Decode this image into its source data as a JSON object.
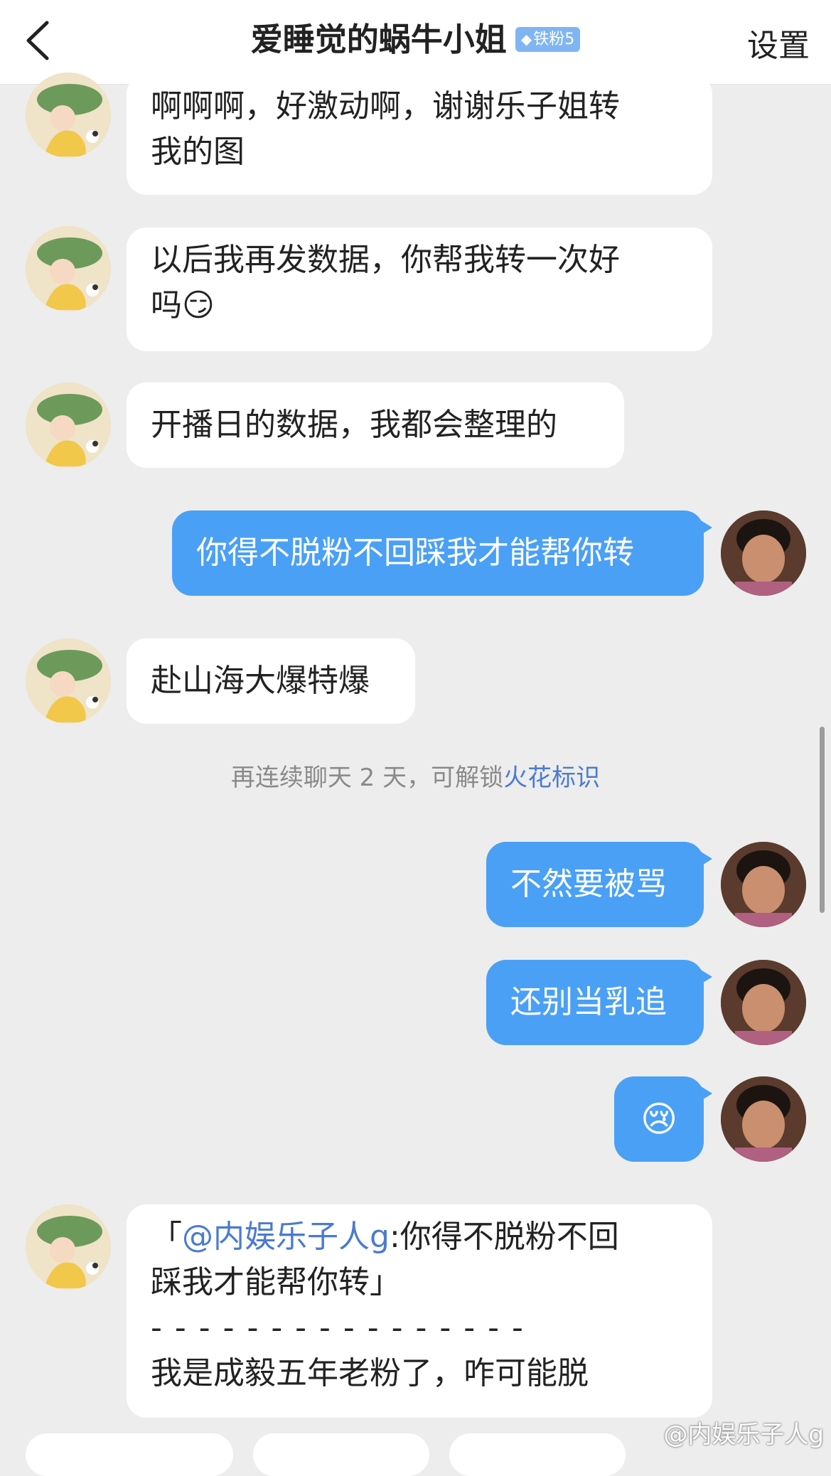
{
  "header": {
    "title": "爱睡觉的蜗牛小姐",
    "badge": "铁粉5",
    "settings_label": "设置"
  },
  "messages": [
    {
      "side": "left",
      "lines": [
        "啊啊啊，好激动啊，谢谢乐子姐转",
        "我的图"
      ]
    },
    {
      "side": "left",
      "lines": [
        "以后我再发数据，你帮我转一次好",
        "吗"
      ]
    },
    {
      "side": "left",
      "text": "开播日的数据，我都会整理的"
    },
    {
      "side": "right",
      "text": "你得不脱粉不回踩我才能帮你转"
    },
    {
      "side": "left",
      "text": "赴山海大爆特爆"
    },
    {
      "side": "right",
      "text": "不然要被骂"
    },
    {
      "side": "right",
      "text": "还别当乳追"
    },
    {
      "side": "right",
      "text": "😢"
    },
    {
      "side": "left",
      "quote_open": "「",
      "mention": "@内娱乐子人g",
      "quote_text": ":你得不脱粉不回",
      "quote_line2": "踩我才能帮你转」",
      "divider": "- - - - - - - - - - - - - - - -",
      "reply": "我是成毅五年老粉了，咋可能脱"
    }
  ],
  "system_notice": {
    "text": "再连续聊天 2 天，可解锁",
    "link": "火花标识"
  },
  "emoji": {
    "smirk": "😏",
    "cry": "😢"
  },
  "watermark": "@内娱乐子人g",
  "colors": {
    "my_bubble": "#4aa0f5",
    "link": "#4a7bd0",
    "badge": "#7fb5f3"
  }
}
